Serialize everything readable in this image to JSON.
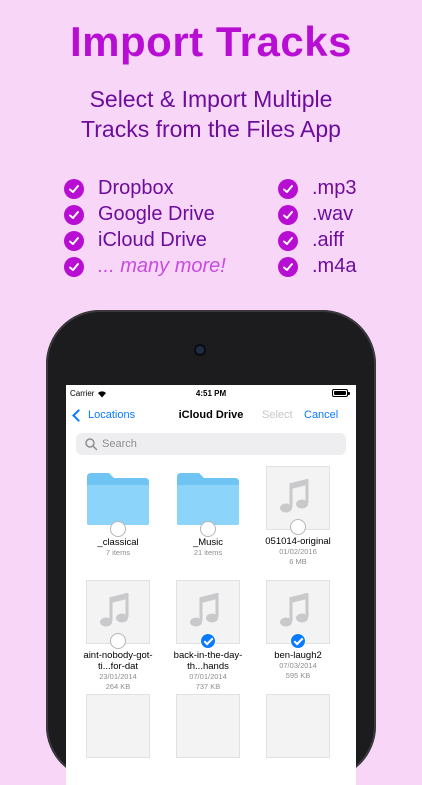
{
  "headline": "Import Tracks",
  "subhead": [
    "Select & Import Multiple",
    "Tracks from the Files App"
  ],
  "sources": [
    "Dropbox",
    "Google Drive",
    "iCloud Drive",
    "... many more!"
  ],
  "formats": [
    ".mp3",
    ".wav",
    ".aiff",
    ".m4a"
  ],
  "colors": {
    "accent": "#b80dd2",
    "text": "#6c0d9b",
    "background": "#f8d6f8",
    "ios_blue": "#0a7aff"
  },
  "status": {
    "carrier": "Carrier",
    "time": "4:51 PM"
  },
  "nav": {
    "back": "Locations",
    "title": "iCloud Drive",
    "select": "Select",
    "cancel": "Cancel"
  },
  "search": {
    "placeholder": "Search"
  },
  "files": [
    {
      "name": "_classical",
      "details": [
        "7 items"
      ],
      "kind": "folder",
      "selected": false
    },
    {
      "name": "_Music",
      "details": [
        "21 items"
      ],
      "kind": "folder",
      "selected": false
    },
    {
      "name": "051014-original",
      "details": [
        "01/02/2016",
        "6 MB"
      ],
      "kind": "audio",
      "selected": false
    },
    {
      "name": "aint-nobody-got-ti...for-dat",
      "details": [
        "23/01/2014",
        "264 KB"
      ],
      "kind": "audio",
      "selected": false
    },
    {
      "name": "back-in-the-day-th...hands",
      "details": [
        "07/01/2014",
        "737 KB"
      ],
      "kind": "audio",
      "selected": true
    },
    {
      "name": "ben-laugh2",
      "details": [
        "07/03/2014",
        "595 KB"
      ],
      "kind": "audio",
      "selected": true
    }
  ]
}
